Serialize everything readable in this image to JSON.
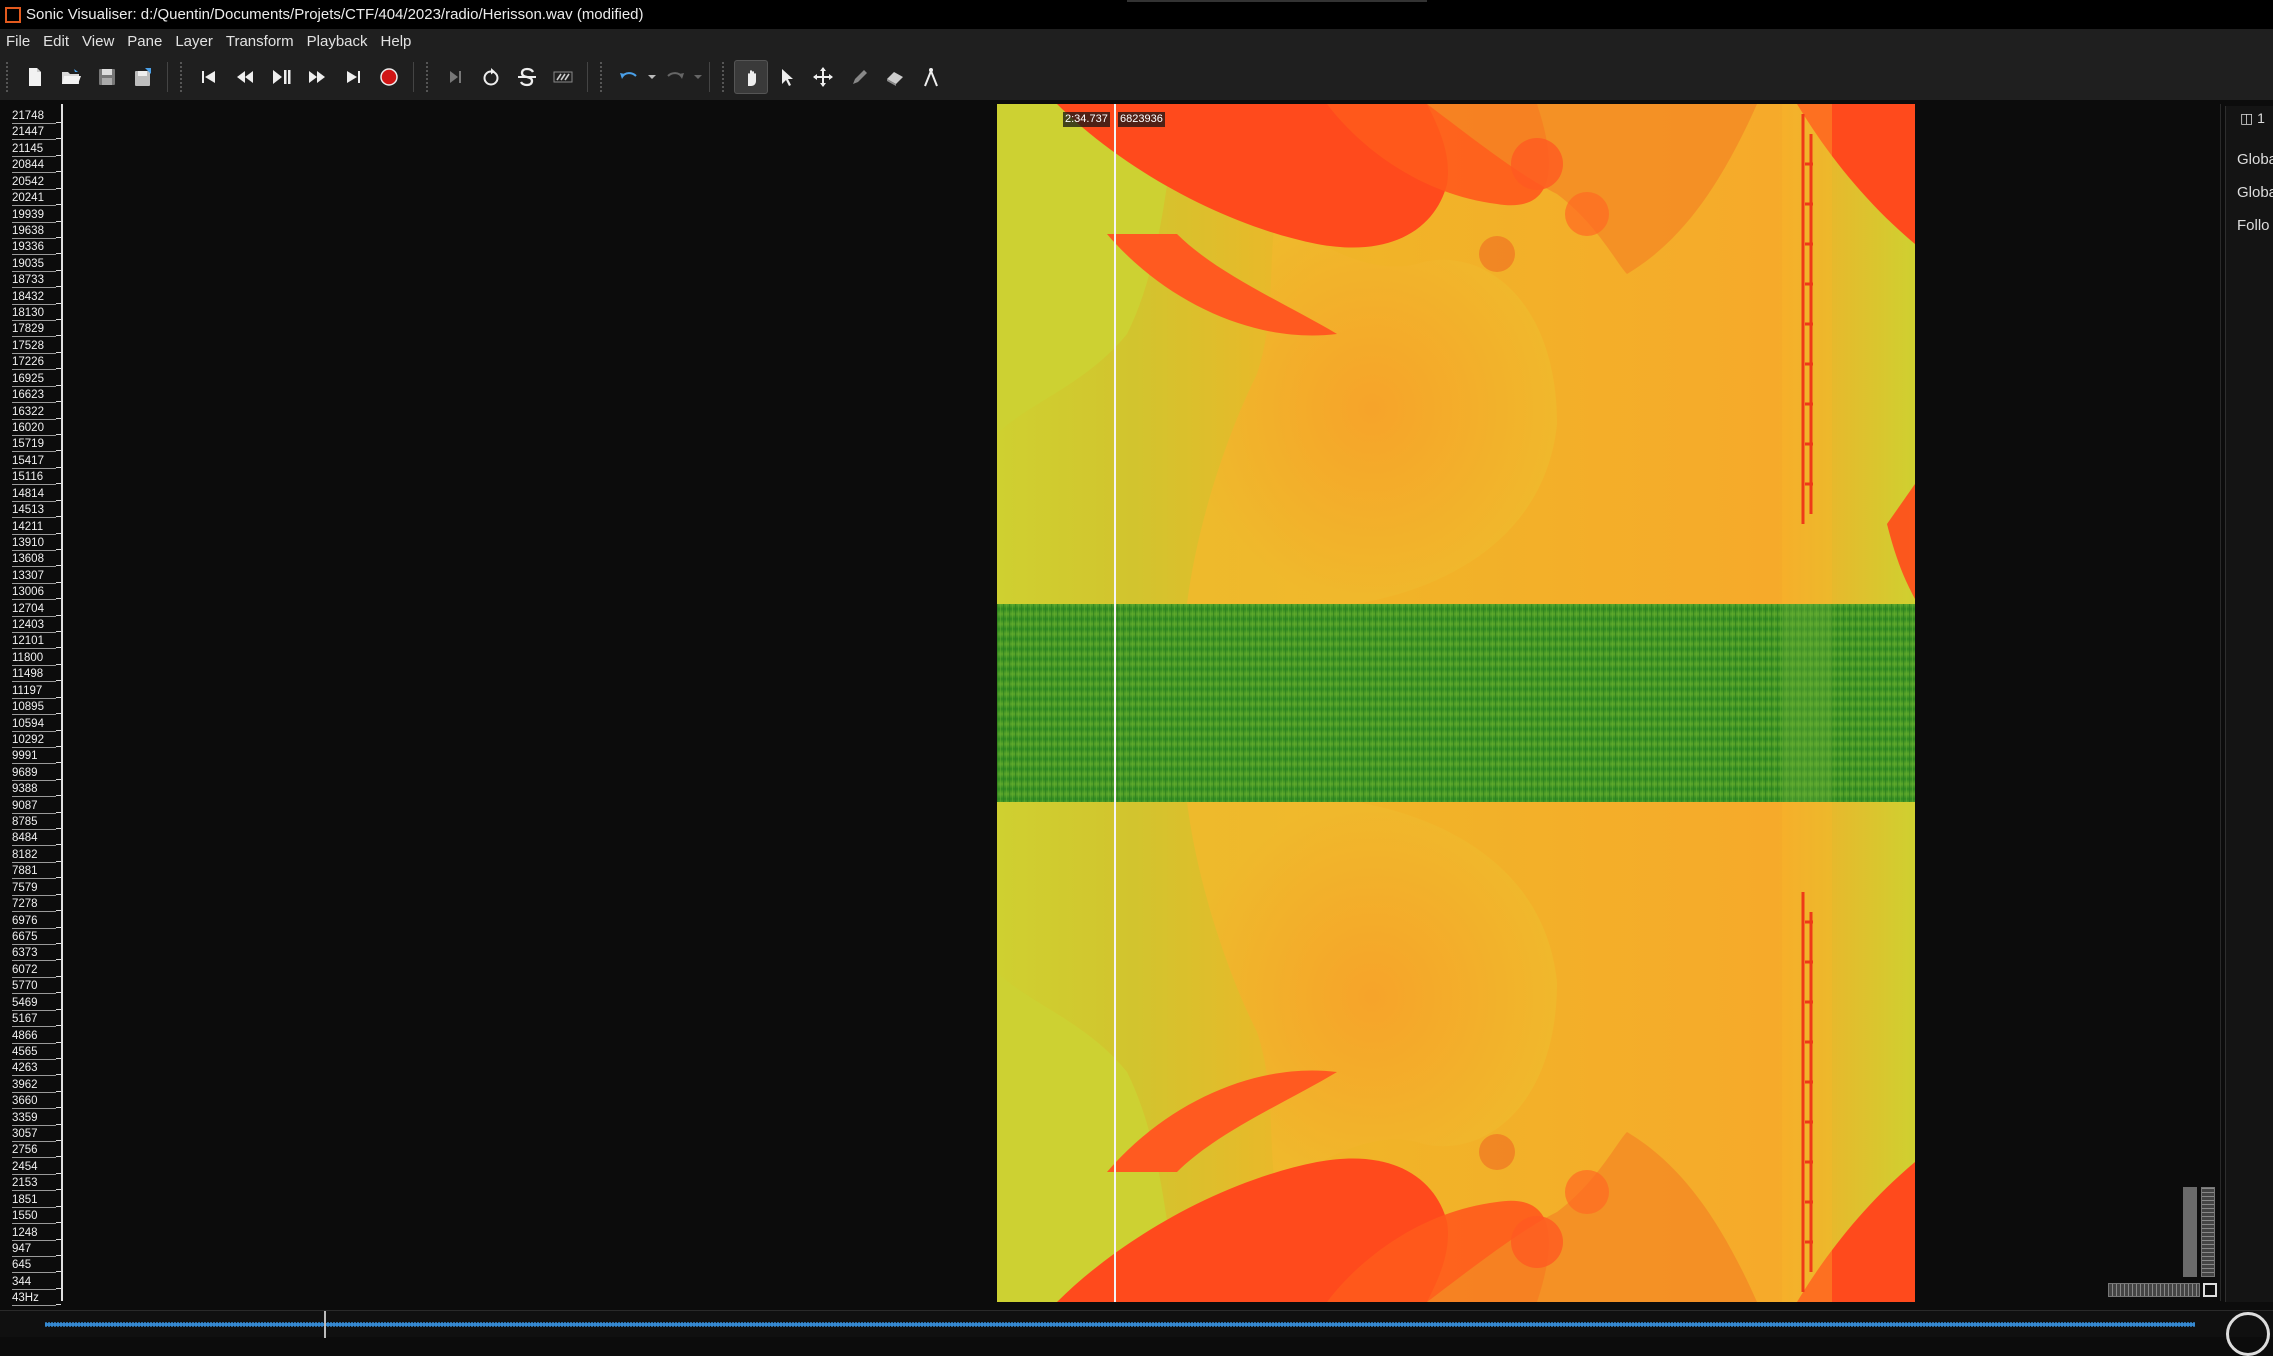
{
  "window": {
    "title": "Sonic Visualiser: d:/Quentin/Documents/Projets/CTF/404/2023/radio/Herisson.wav (modified)"
  },
  "menu": [
    "File",
    "Edit",
    "View",
    "Pane",
    "Layer",
    "Transform",
    "Playback",
    "Help"
  ],
  "toolbar": {
    "groups": [
      [
        "new-file-icon",
        "open-folder-icon",
        "save-icon",
        "save-as-icon"
      ],
      [
        "rewind-start-icon",
        "rewind-icon",
        "play-pause-icon",
        "fast-forward-icon",
        "fast-forward-end-icon",
        "record-icon"
      ],
      [
        "play-selection-icon",
        "loop-icon",
        "solo-icon",
        "speedup-icon"
      ],
      [
        "undo-icon",
        "redo-icon"
      ],
      [
        "navigate-tool-icon",
        "select-tool-icon",
        "move-tool-icon",
        "draw-tool-icon",
        "erase-tool-icon",
        "measure-tool-icon"
      ]
    ],
    "active_tool": "navigate-tool-icon"
  },
  "frequency_scale": {
    "labels": [
      "21748",
      "21447",
      "21145",
      "20844",
      "20542",
      "20241",
      "19939",
      "19638",
      "19336",
      "19035",
      "18733",
      "18432",
      "18130",
      "17829",
      "17528",
      "17226",
      "16925",
      "16623",
      "16322",
      "16020",
      "15719",
      "15417",
      "15116",
      "14814",
      "14513",
      "14211",
      "13910",
      "13608",
      "13307",
      "13006",
      "12704",
      "12403",
      "12101",
      "11800",
      "11498",
      "11197",
      "10895",
      "10594",
      "10292",
      "9991",
      "9689",
      "9388",
      "9087",
      "8785",
      "8484",
      "8182",
      "7881",
      "7579",
      "7278",
      "6976",
      "6675",
      "6373",
      "6072",
      "5770",
      "5469",
      "5167",
      "4866",
      "4565",
      "4263",
      "3962",
      "3660",
      "3359",
      "3057",
      "2756",
      "2454",
      "2153",
      "1851",
      "1550",
      "1248",
      "947",
      "645",
      "344",
      "43Hz"
    ]
  },
  "playhead": {
    "time": "2:34.737",
    "frame": "6823936"
  },
  "properties_panel": {
    "tab_label": "1",
    "rows": [
      "Globa",
      "Globa",
      "Follo"
    ]
  },
  "colors": {
    "spectrogram_high": "#ff4a1c",
    "spectrogram_mid": "#f2a62a",
    "spectrogram_low": "#d4cf2e",
    "band_green": "#3f9a26",
    "overview_waveform": "#3a8fd6"
  }
}
